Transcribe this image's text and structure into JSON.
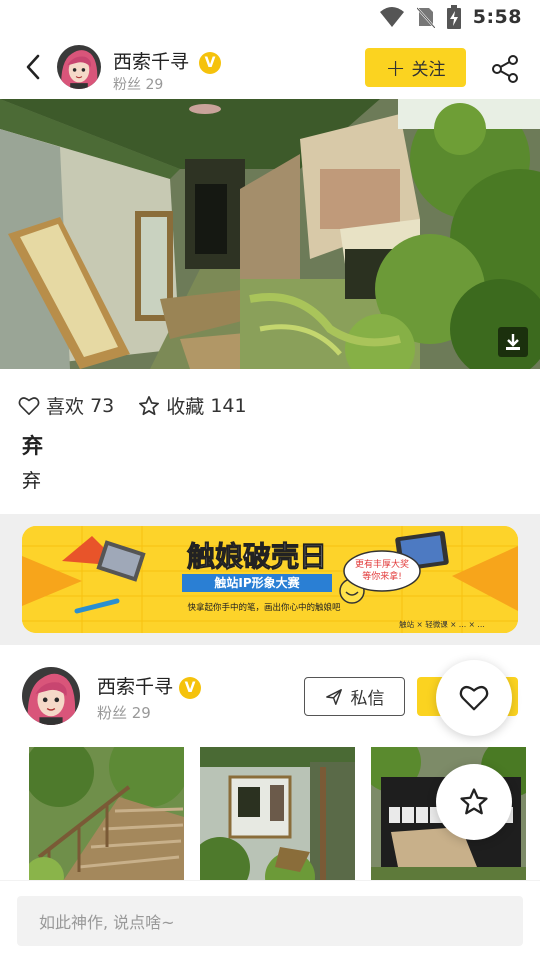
{
  "status_bar": {
    "time": "5:58"
  },
  "header": {
    "username": "西索千寻",
    "verified_badge": "V",
    "fans": "粉丝 29",
    "follow_label": "关注",
    "accent": "#fbd320"
  },
  "stats": {
    "likes_label": "喜欢",
    "likes_count": "73",
    "favorites_label": "收藏",
    "favorites_count": "141"
  },
  "post": {
    "title": "弃",
    "description": "弃"
  },
  "banner": {
    "title": "触娘破壳日",
    "subtitle": "触站IP形象大赛",
    "tagline": "快拿起你手中的笔，画出你心中的触娘吧",
    "bubble_line1": "更有丰厚大奖",
    "bubble_line2": "等你来拿!",
    "sponsors": "触站 × 轻微课 × … × …"
  },
  "author": {
    "username": "西索千寻",
    "verified_badge": "V",
    "fans": "粉丝 29",
    "message_label": "私信"
  },
  "comment": {
    "placeholder": "如此神作, 说点啥~"
  },
  "icons": {
    "back": "chevron-left-icon",
    "share": "share-icon",
    "download": "download-icon",
    "heart": "heart-icon",
    "star": "star-icon",
    "send": "send-icon",
    "wifi": "wifi-icon",
    "no_sim": "no-sim-icon",
    "battery": "battery-charging-icon"
  }
}
